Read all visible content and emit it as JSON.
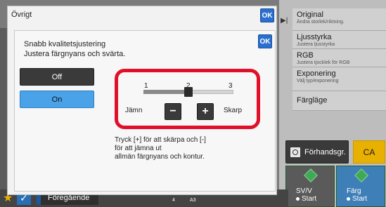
{
  "outer": {
    "title": "Övrigt",
    "ok_label": "OK"
  },
  "inner": {
    "title_line1": "Snabb kvalitetsjustering",
    "title_line2": "Justera färgnyans och svärta.",
    "ok_label": "OK",
    "off_label": "Off",
    "on_label": "On",
    "selected": "On"
  },
  "slider": {
    "ticks": [
      "1",
      "2",
      "3"
    ],
    "value": 2,
    "min": 1,
    "max": 3,
    "left_label": "Jämn",
    "right_label": "Skarp",
    "minus_label": "−",
    "plus_label": "+"
  },
  "help": {
    "line1": "Tryck [+] för att skärpa och [-]",
    "line2": "för att jämna ut",
    "line3": "allmän färgnyans och kontur."
  },
  "right_menu": [
    {
      "title": "Original",
      "sub": "Ändra storlek/riktning."
    },
    {
      "title": "Ljusstyrka",
      "sub": "Justera ljusstyrka"
    },
    {
      "title": "RGB",
      "sub": "Justera tjocklek för RGB"
    },
    {
      "title": "Exponering",
      "sub": "Välj typ/exponering"
    },
    {
      "title": "Färgläge",
      "sub": ""
    }
  ],
  "actions": {
    "preview_label": "Förhandsgr.",
    "ca_label": "CA",
    "start_bw_line1": "SV/V",
    "start_bw_line2": "Start",
    "start_color_line1": "Färg",
    "start_color_line2": "Start"
  },
  "bottom": {
    "prev_label": "Föregående",
    "page_num": "4",
    "paper_size": "A3"
  },
  "colors": {
    "highlight": "#e0102a",
    "ok_blue": "#2a6fd0",
    "on_blue": "#4aa3e8",
    "ca_yellow": "#e8b000",
    "start_green": "#3faa55"
  }
}
